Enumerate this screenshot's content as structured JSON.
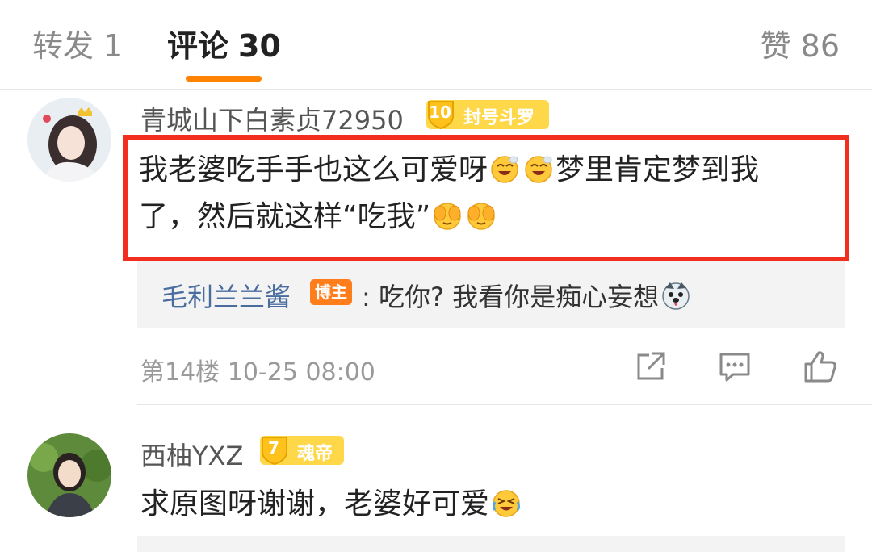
{
  "tabs": {
    "repost": {
      "label": "转发",
      "count": "1"
    },
    "comments": {
      "label": "评论",
      "count": "30"
    },
    "likes": {
      "label": "赞",
      "count": "86"
    }
  },
  "colors": {
    "accent": "#ff8200",
    "highlight": "#f22e1e",
    "link": "#4a6da0",
    "badge": "#ffd84a",
    "author_tag": "#ff7d1a"
  },
  "comments": [
    {
      "username": "青城山下白素贞72950",
      "level": "10",
      "title": "封号斗罗",
      "text_line1_a": "我老婆吃手手也这么可爱呀",
      "text_line1_b": "梦里肯定梦到我",
      "text_line2": "了，然后就这样“吃我”",
      "emojis": [
        "drool-emoji",
        "drool-emoji",
        "cover-face-emoji",
        "cover-face-emoji"
      ],
      "reply": {
        "author": "毛利兰兰酱",
        "author_tag": "博主",
        "text": ": 吃你? 我看你是痴心妄想",
        "emoji": "husky-emoji"
      },
      "floor": "第14楼",
      "time": "10-25 08:00"
    },
    {
      "username": "西柚YXZ",
      "level": "7",
      "title": "魂帝",
      "text": "求原图呀谢谢，老婆好可爱",
      "emoji": "laugh-cry-emoji"
    }
  ]
}
